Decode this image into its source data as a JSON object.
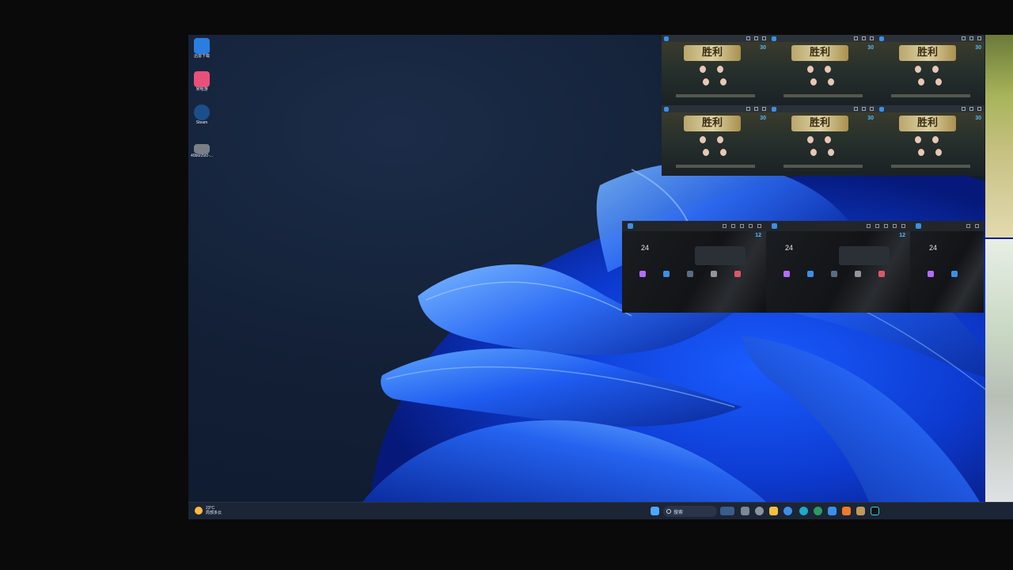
{
  "desktop": {
    "icons": [
      {
        "label": "迅雷下载",
        "icon": "cube-app-icon",
        "color": "#2b7de0"
      },
      {
        "label": "米哈游",
        "icon": "pink-app-icon",
        "color": "#e8507a"
      },
      {
        "label": "Steam",
        "icon": "steam-icon",
        "color": "#1b4f8c"
      },
      {
        "label": "40b6f25f2-...",
        "icon": "file-icon",
        "color": "#7a7f86"
      }
    ]
  },
  "game_windows": [
    {
      "title": "胜利",
      "count": "30"
    },
    {
      "title": "胜利",
      "count": "30"
    },
    {
      "title": "胜利",
      "count": "30"
    },
    {
      "title": "胜利",
      "count": "30"
    },
    {
      "title": "胜利",
      "count": "30"
    },
    {
      "title": "胜利",
      "count": "30"
    }
  ],
  "launcher_windows": [
    {
      "big": "24",
      "small": "12"
    },
    {
      "big": "24",
      "small": "12"
    },
    {
      "big": "24",
      "small": ""
    }
  ],
  "taskbar": {
    "weather_temp": "23°C",
    "weather_desc": "局部多云",
    "search_placeholder": "搜索",
    "accent": "#3c8fe8"
  }
}
